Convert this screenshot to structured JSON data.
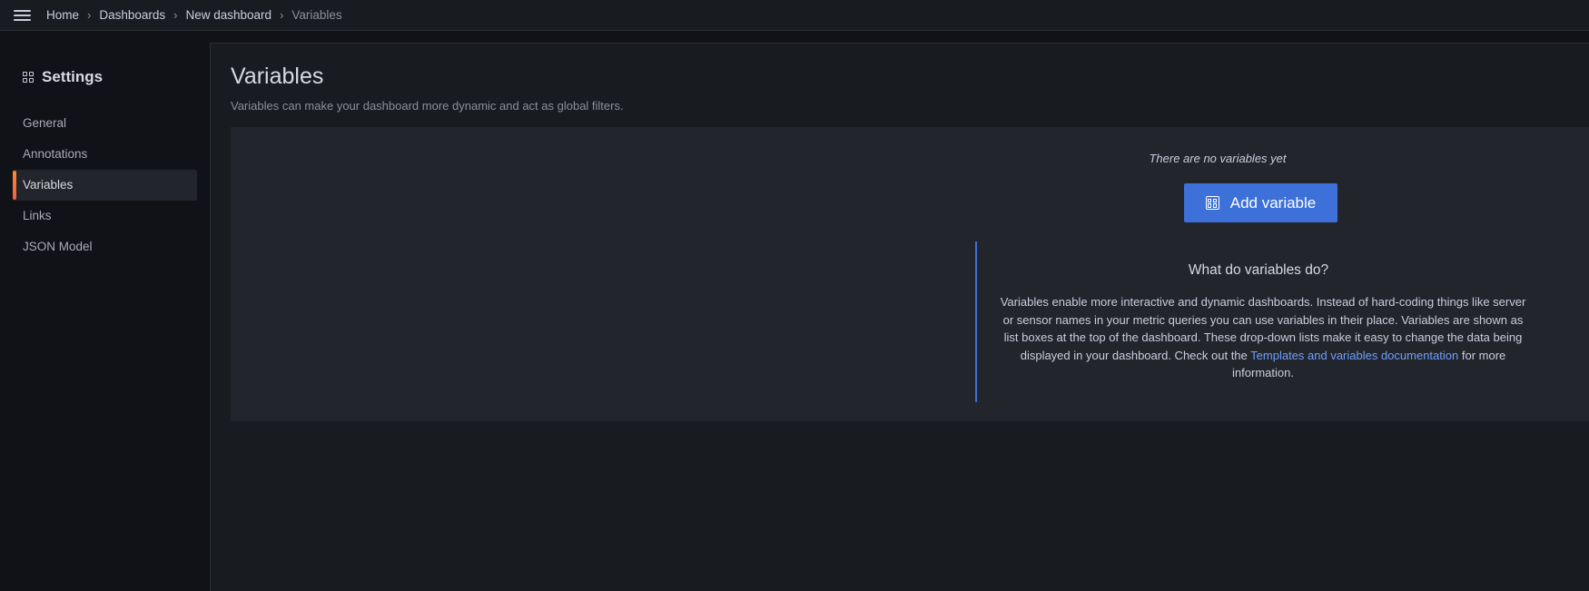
{
  "breadcrumb": {
    "home": "Home",
    "dashboards": "Dashboards",
    "new_dashboard": "New dashboard",
    "current": "Variables",
    "separator": "›"
  },
  "sidebar": {
    "title": "Settings",
    "items": [
      {
        "label": "General"
      },
      {
        "label": "Annotations"
      },
      {
        "label": "Variables"
      },
      {
        "label": "Links"
      },
      {
        "label": "JSON Model"
      }
    ],
    "active_index": 2
  },
  "main": {
    "title": "Variables",
    "subtitle": "Variables can make your dashboard more dynamic and act as global filters.",
    "empty_message": "There are no variables yet",
    "add_button_label": "Add variable",
    "info": {
      "title": "What do variables do?",
      "text_before_link": "Variables enable more interactive and dynamic dashboards. Instead of hard-coding things like server or sensor names in your metric queries you can use variables in their place. Variables are shown as list boxes at the top of the dashboard. These drop-down lists make it easy to change the data being displayed in your dashboard. Check out the ",
      "link_text": "Templates and variables documentation",
      "text_after_link": " for more information."
    }
  },
  "colors": {
    "accent": "#3d71d9",
    "active_indicator": "#f55f3e",
    "link": "#6e9fff",
    "background": "#111217",
    "panel": "#22252b"
  },
  "icons": {
    "menu": "hamburger-menu-icon",
    "settings": "apps-grid-icon",
    "add_variable": "calculator-icon"
  }
}
